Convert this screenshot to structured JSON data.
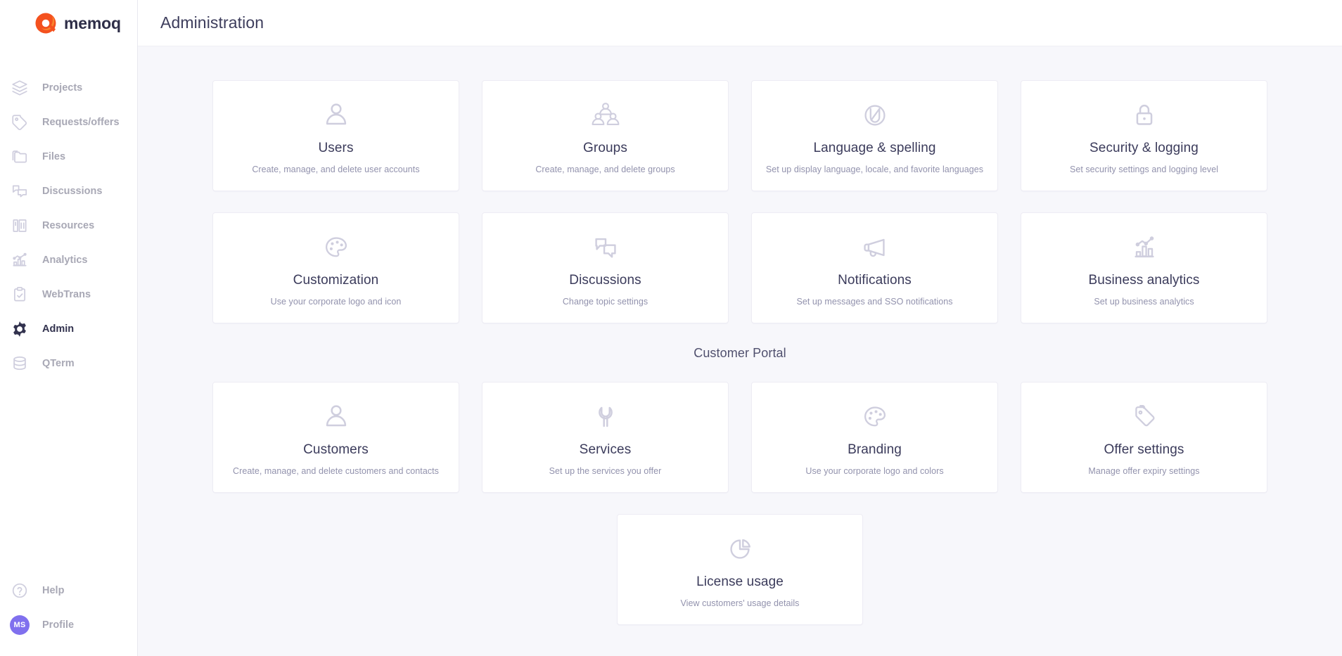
{
  "brand": {
    "logo_icon": "memoq-logo-icon",
    "name": "memoq",
    "accent_color": "#f05a28",
    "wordmark_color": "#2e2e48"
  },
  "sidebar": {
    "items": [
      {
        "label": "Projects",
        "icon": "layers-icon",
        "active": false
      },
      {
        "label": "Requests/offers",
        "icon": "tag-icon",
        "active": false
      },
      {
        "label": "Files",
        "icon": "folders-icon",
        "active": false
      },
      {
        "label": "Discussions",
        "icon": "chat-icon",
        "active": false
      },
      {
        "label": "Resources",
        "icon": "resources-icon",
        "active": false
      },
      {
        "label": "Analytics",
        "icon": "analytics-icon",
        "active": false
      },
      {
        "label": "WebTrans",
        "icon": "clipboard-icon",
        "active": false
      },
      {
        "label": "Admin",
        "icon": "gear-icon",
        "active": true
      },
      {
        "label": "QTerm",
        "icon": "database-icon",
        "active": false
      }
    ],
    "bottom": [
      {
        "label": "Help",
        "icon": "help-circle-icon"
      },
      {
        "label": "Profile",
        "icon": "avatar-icon",
        "initials": "MS",
        "avatar_color": "#8070ee"
      }
    ]
  },
  "header": {
    "title": "Administration"
  },
  "main": {
    "admin_cards": [
      {
        "title": "Users",
        "subtitle": "Create, manage, and delete user accounts",
        "icon": "user-icon"
      },
      {
        "title": "Groups",
        "subtitle": "Create, manage, and delete groups",
        "icon": "group-icon"
      },
      {
        "title": "Language & spelling",
        "subtitle": "Set up display language, locale, and favorite languages",
        "icon": "language-globe-icon"
      },
      {
        "title": "Security & logging",
        "subtitle": "Set security settings and logging level",
        "icon": "lock-icon"
      },
      {
        "title": "Customization",
        "subtitle": "Use your corporate logo and icon",
        "icon": "palette-icon"
      },
      {
        "title": "Discussions",
        "subtitle": "Change topic settings",
        "icon": "chat-bubbles-icon"
      },
      {
        "title": "Notifications",
        "subtitle": "Set up messages and SSO notifications",
        "icon": "megaphone-icon"
      },
      {
        "title": "Business analytics",
        "subtitle": "Set up business analytics",
        "icon": "bar-chart-icon"
      }
    ],
    "section_title": "Customer Portal",
    "portal_cards": [
      {
        "title": "Customers",
        "subtitle": "Create, manage, and delete customers and contacts",
        "icon": "user-icon"
      },
      {
        "title": "Services",
        "subtitle": "Set up the services you offer",
        "icon": "wrench-icon"
      },
      {
        "title": "Branding",
        "subtitle": "Use your corporate logo and colors",
        "icon": "palette-icon"
      },
      {
        "title": "Offer settings",
        "subtitle": "Manage offer expiry settings",
        "icon": "price-tag-icon"
      }
    ],
    "license_card": {
      "title": "License usage",
      "subtitle": "View customers' usage details",
      "icon": "pie-chart-icon"
    }
  },
  "colors": {
    "page_bg": "#f7f7fb",
    "card_bg": "#ffffff",
    "card_border": "#edecf4",
    "icon": "#cfcede",
    "title_text": "#3b3b5b",
    "sub_text": "#9292ad",
    "nav_inactive": "#a8a8b5",
    "nav_active": "#32324e"
  }
}
